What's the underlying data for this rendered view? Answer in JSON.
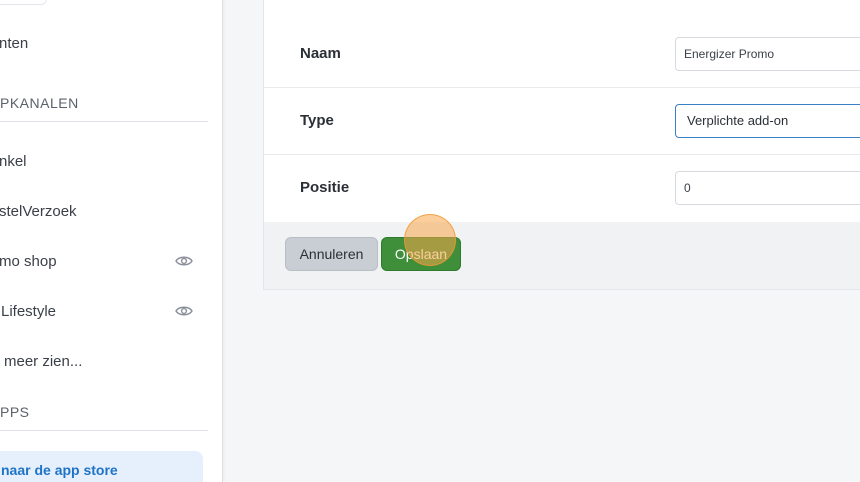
{
  "sidebar": {
    "items_top": [
      {
        "label": "nten"
      }
    ],
    "section_sales": "PKANALEN",
    "channels": [
      {
        "label": "nkel",
        "eye": false
      },
      {
        "label": "stelVerzoek",
        "eye": false
      },
      {
        "label": "mo shop",
        "eye": true,
        "icon": "eye-icon"
      },
      {
        "label": "Lifestyle",
        "eye": true,
        "icon": "eye-icon"
      },
      {
        "label": "meer zien...",
        "eye": false
      }
    ],
    "section_apps": "PPS",
    "app_store_link": "naar de app store"
  },
  "form": {
    "rows": [
      {
        "label": "Naam",
        "value": "Energizer Promo"
      },
      {
        "label": "Type",
        "value": "Verplichte add-on"
      },
      {
        "label": "Positie",
        "value": "0"
      }
    ],
    "cancel_label": "Annuleren",
    "save_label": "Opslaan"
  },
  "colors": {
    "save": "#3f8f3a",
    "cancel": "#c9ced4",
    "accent_link": "#1f73c7",
    "select_border": "#3b7fc4",
    "click_indicator": "#f8a64a"
  }
}
